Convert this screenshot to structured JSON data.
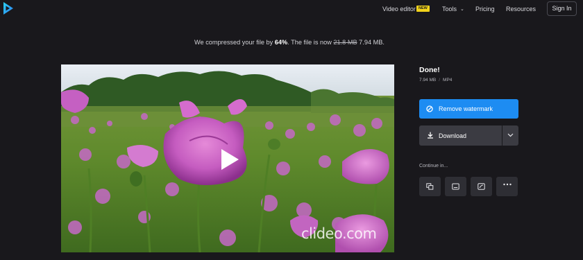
{
  "header": {
    "logo": "clideo-play-logo",
    "nav": {
      "video_editor": "Video editor",
      "video_editor_badge": "NEW",
      "tools": "Tools",
      "pricing": "Pricing",
      "resources": "Resources"
    },
    "sign_in": "Sign In"
  },
  "message": {
    "prefix": "We compressed your file by ",
    "percent": "64%",
    "middle": ". The file is now ",
    "old_size": "21.8 MB",
    "new_size": "7.94 MB."
  },
  "video": {
    "watermark": "clideo.com",
    "play_icon": "play-icon"
  },
  "result": {
    "title": "Done!",
    "size": "7.94 MB",
    "separator": "/",
    "format": "MP4",
    "remove_watermark": "Remove watermark",
    "download": "Download",
    "continue_label": "Continue in..."
  },
  "colors": {
    "background": "#19181c",
    "accent": "#1d8cf2",
    "badge": "#f2d21b",
    "button_dark": "#3b3b42"
  }
}
